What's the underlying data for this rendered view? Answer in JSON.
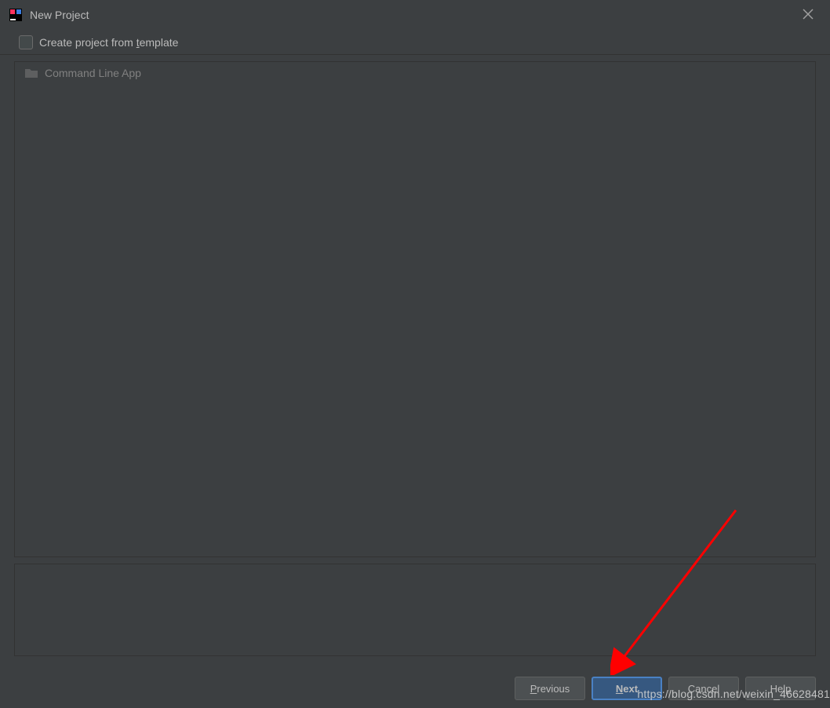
{
  "window": {
    "title": "New Project"
  },
  "checkbox": {
    "label_pre": "Create project from ",
    "label_underline": "t",
    "label_post": "emplate"
  },
  "templates": [
    {
      "name": "Command Line App"
    }
  ],
  "buttons": {
    "previous_u": "P",
    "previous_rest": "revious",
    "next_u": "N",
    "next_rest": "ext",
    "cancel": "Cancel",
    "help": "Help"
  },
  "watermark": "https://blog.csdn.net/weixin_46628481",
  "colors": {
    "background": "#3c3f41",
    "border": "#323232",
    "text": "#bbbbbb",
    "text_dim": "#808080",
    "button_bg": "#4c5052",
    "button_primary_bg": "#365880",
    "button_primary_border": "#4a81c4",
    "arrow": "#ff0000"
  }
}
